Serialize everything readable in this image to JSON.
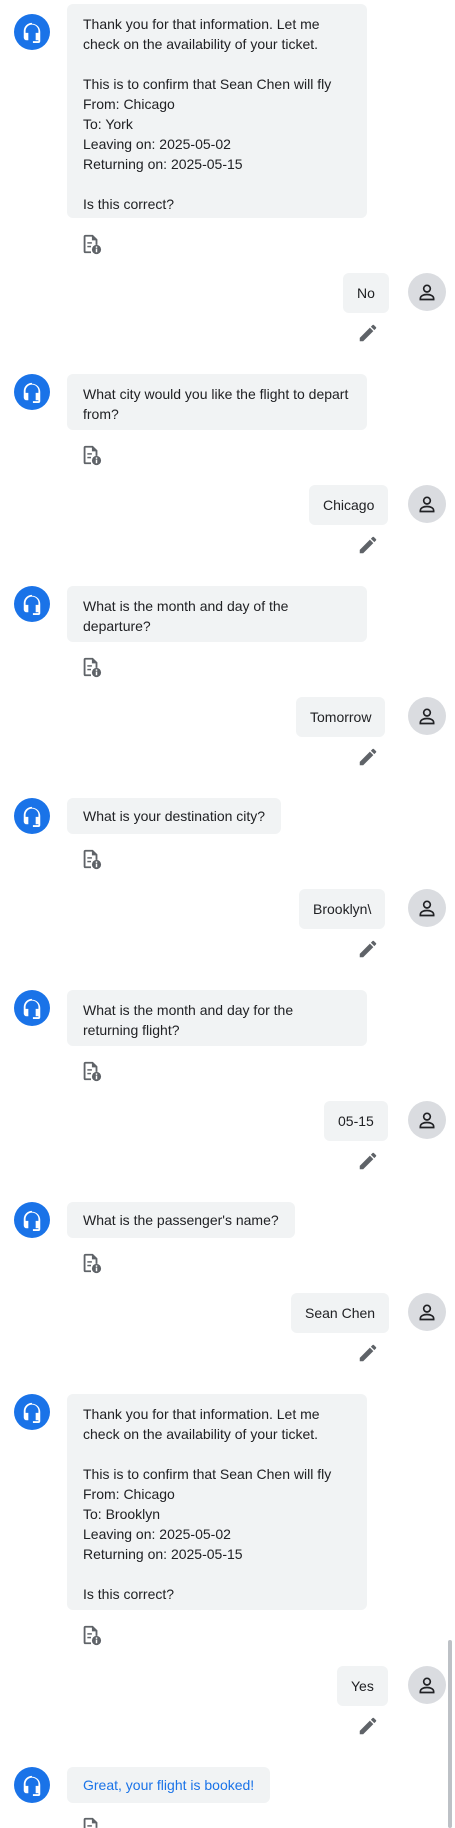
{
  "conversation": {
    "messages": [
      {
        "role": "bot",
        "text": "Thank you for that information. Let me check on the availability of your ticket.\n\n This is to confirm that Sean Chen will fly\nFrom: Chicago\nTo: York\nLeaving on: 2025-05-02\nReturning on: 2025-05-15\n\nIs this correct?"
      },
      {
        "role": "user",
        "text": "No"
      },
      {
        "role": "bot",
        "text": "What city would you like the flight to depart from?"
      },
      {
        "role": "user",
        "text": "Chicago"
      },
      {
        "role": "bot",
        "text": "What is the month and day of the departure?"
      },
      {
        "role": "user",
        "text": "Tomorrow"
      },
      {
        "role": "bot",
        "text": "What is your destination city?"
      },
      {
        "role": "user",
        "text": "Brooklyn\\"
      },
      {
        "role": "bot",
        "text": "What is the month and day for the returning flight?"
      },
      {
        "role": "user",
        "text": "05-15"
      },
      {
        "role": "bot",
        "text": "What is the passenger's name?"
      },
      {
        "role": "user",
        "text": "Sean Chen"
      },
      {
        "role": "bot",
        "text": "Thank you for that information. Let me check on the availability of your ticket.\n\n This is to confirm that Sean Chen will fly\nFrom: Chicago\nTo: Brooklyn\nLeaving on: 2025-05-02\nReturning on: 2025-05-15\n\nIs this correct?"
      },
      {
        "role": "user",
        "text": "Yes"
      },
      {
        "role": "bot",
        "text": "Great, your flight is booked!"
      }
    ]
  },
  "icons": {
    "bot_avatar": "headset-icon",
    "user_avatar": "person-icon",
    "bot_message_action": "document-info-icon",
    "user_message_action": "pencil-edit-icon"
  },
  "colors": {
    "accent": "#1a73e8",
    "bubble": "#f1f3f4",
    "user_avatar_bg": "#dadce0",
    "final_message_text": "#1a73e8"
  }
}
